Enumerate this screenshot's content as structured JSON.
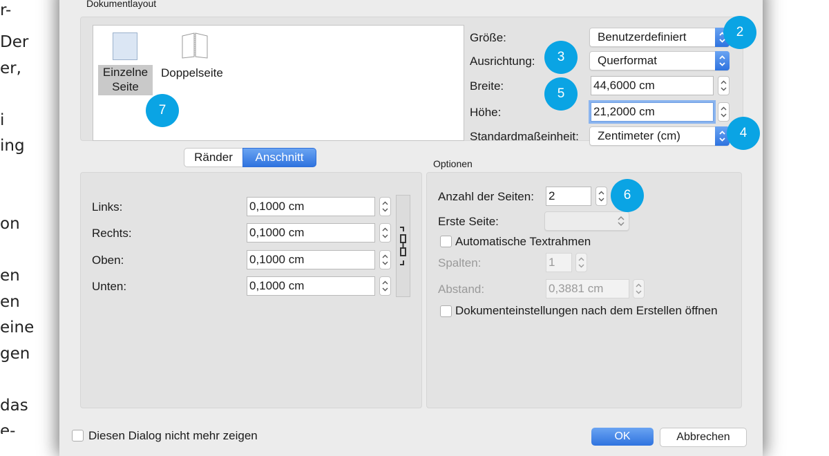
{
  "article_lines": [
    "r-",
    "Der",
    "er,",
    "i",
    "ing",
    "on",
    "en",
    "en",
    "eine",
    "gen",
    "das",
    "e-"
  ],
  "dialog": {
    "section_title": "Dokumentlayout",
    "layout_options": [
      {
        "label_line1": "Einzelne",
        "label_line2": "Seite",
        "selected": true
      },
      {
        "label": "Doppelseite",
        "selected": false
      }
    ],
    "size": {
      "label": "Größe:",
      "value": "Benutzerdefiniert"
    },
    "orientation": {
      "label": "Ausrichtung:",
      "value": "Querformat"
    },
    "width": {
      "label": "Breite:",
      "value": "44,6000 cm"
    },
    "height": {
      "label": "Höhe:",
      "value": "21,2000 cm"
    },
    "unit": {
      "label": "Standardmaßeinheit:",
      "value": "Zentimeter (cm)"
    },
    "tabs": [
      {
        "label": "Ränder",
        "active": false
      },
      {
        "label": "Anschnitt",
        "active": true
      }
    ],
    "margins": [
      {
        "label": "Links:",
        "value": "0,1000 cm"
      },
      {
        "label": "Rechts:",
        "value": "0,1000 cm"
      },
      {
        "label": "Oben:",
        "value": "0,1000 cm"
      },
      {
        "label": "Unten:",
        "value": "0,1000 cm"
      }
    ],
    "options": {
      "title": "Optionen",
      "page_count": {
        "label": "Anzahl der Seiten:",
        "value": "2"
      },
      "first_page": {
        "label": "Erste Seite:",
        "value": ""
      },
      "auto_text_frames": {
        "label": "Automatische Textrahmen",
        "checked": false
      },
      "columns": {
        "label": "Spalten:",
        "value": "1"
      },
      "spacing": {
        "label": "Abstand:",
        "value": "0,3881 cm"
      },
      "open_settings": {
        "label": "Dokumenteinstellungen nach dem Erstellen öffnen",
        "checked": false
      }
    },
    "footer": {
      "dont_show_label": "Diesen Dialog nicht mehr zeigen",
      "ok_label": "OK",
      "cancel_label": "Abbrechen"
    }
  },
  "callouts": [
    "2",
    "3",
    "4",
    "5",
    "6",
    "7"
  ],
  "colors": {
    "accent": "#2f73df",
    "callout": "#0aa4e4",
    "selection": "#c9c9c9"
  }
}
